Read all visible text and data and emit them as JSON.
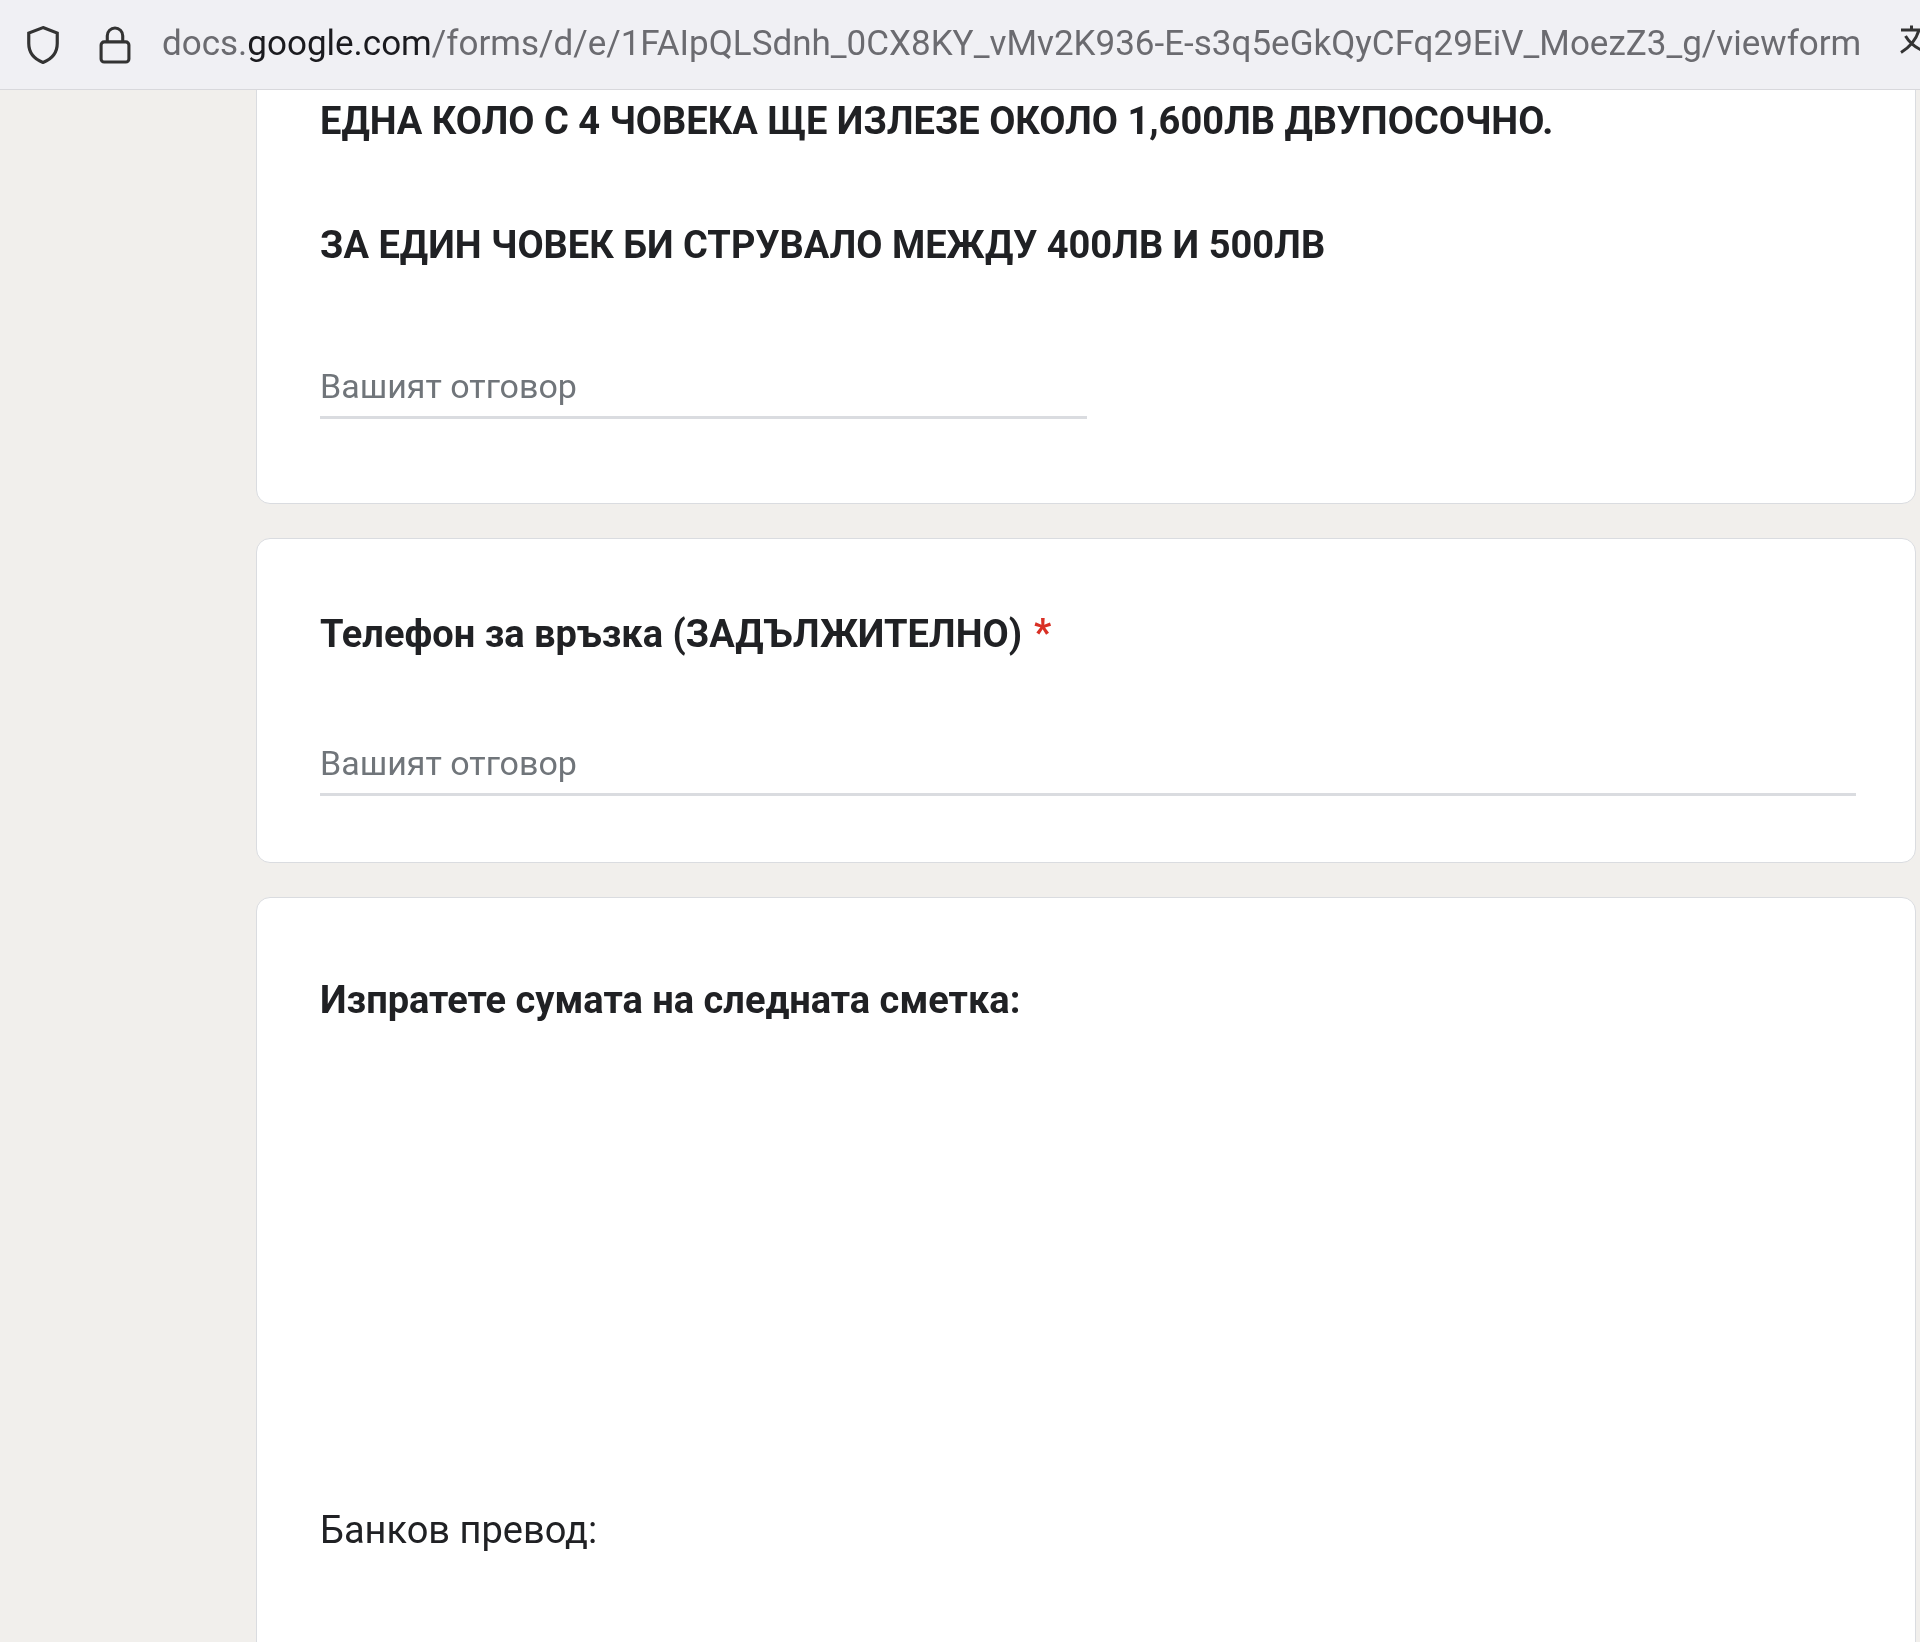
{
  "browser": {
    "url": "docs.**google.com**/forms/d/e/1FAIpQLSdnh_0CX8KY_vMv2K936-E-s3q5eGkQyCFq29EiV_MoezZ3_g/viewform"
  },
  "cards": [
    {
      "kind": "question",
      "title_lines": [
        "ЕДНА КОЛО С 4 ЧОВЕКА ЩЕ ИЗЛЕЗЕ ОКОЛО 1,600ЛВ ДВУПОСОЧНО.",
        "ЗА ЕДИН ЧОВЕК БИ СТРУВАЛО МЕЖДУ 400ЛВ И 500ЛВ"
      ],
      "placeholder": "Вашият отговор"
    },
    {
      "kind": "question",
      "title_lines": [
        "Телефон за връзка (ЗАДЪЛЖИТЕЛНО)"
      ],
      "required_mark": "*",
      "placeholder": "Вашият отговор"
    },
    {
      "kind": "info",
      "title_lines": [
        "Изпратете сумата на следната сметка:"
      ],
      "body": "Банков превод:"
    }
  ]
}
